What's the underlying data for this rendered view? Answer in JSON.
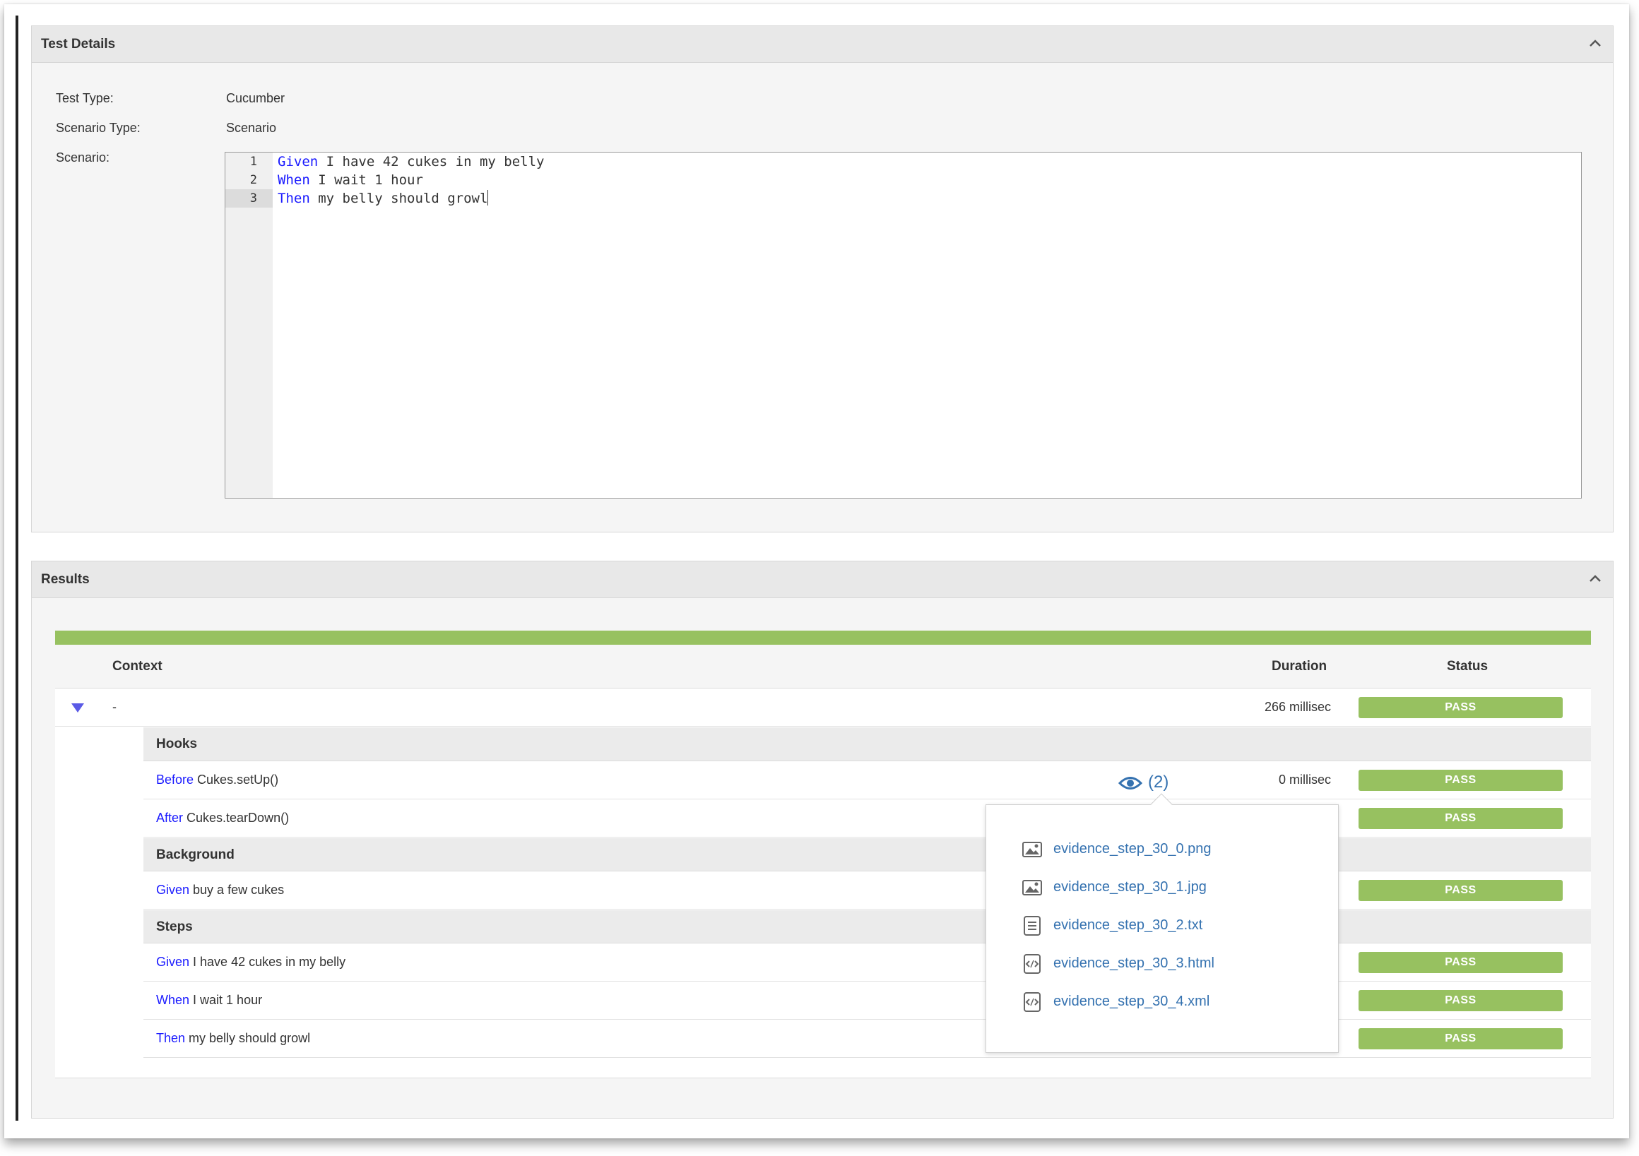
{
  "test_details": {
    "title": "Test Details",
    "fields": {
      "test_type_label": "Test Type:",
      "test_type_value": "Cucumber",
      "scenario_type_label": "Scenario Type:",
      "scenario_type_value": "Scenario",
      "scenario_label": "Scenario:"
    },
    "scenario_lines": [
      {
        "n": "1",
        "kw": "Given",
        "text": " I have 42 cukes in my belly"
      },
      {
        "n": "2",
        "kw": "When",
        "text": " I wait 1 hour"
      },
      {
        "n": "3",
        "kw": "Then",
        "text": " my belly should growl"
      }
    ]
  },
  "results": {
    "title": "Results",
    "progress_pass_fraction": 1.0,
    "columns": {
      "context": "Context",
      "duration": "Duration",
      "status": "Status"
    },
    "summary_row": {
      "context": "-",
      "duration": "266 millisec",
      "status": "PASS"
    },
    "sections": {
      "hooks": "Hooks",
      "background": "Background",
      "steps": "Steps"
    },
    "hooks": [
      {
        "kw": "Before",
        "text": " Cukes.setUp()",
        "duration": "0 millisec",
        "status": "PASS",
        "evidence_count": "(2)"
      },
      {
        "kw": "After",
        "text": " Cukes.tearDown()",
        "status": "PASS"
      }
    ],
    "background": [
      {
        "kw": "Given",
        "text": " buy a few cukes",
        "status": "PASS"
      }
    ],
    "steps": [
      {
        "kw": "Given",
        "text": " I have 42 cukes in my belly",
        "status": "PASS"
      },
      {
        "kw": "When",
        "text": " I wait 1 hour",
        "status": "PASS"
      },
      {
        "kw": "Then",
        "text": " my belly should growl",
        "status": "PASS"
      }
    ],
    "evidence_files": [
      {
        "name": "evidence_step_30_0.png",
        "icon": "image-file-icon"
      },
      {
        "name": "evidence_step_30_1.jpg",
        "icon": "image-file-icon"
      },
      {
        "name": "evidence_step_30_2.txt",
        "icon": "text-file-icon"
      },
      {
        "name": "evidence_step_30_3.html",
        "icon": "code-file-icon"
      },
      {
        "name": "evidence_step_30_4.xml",
        "icon": "code-file-icon"
      }
    ]
  },
  "colors": {
    "pass": "#97c160",
    "keyword": "#1a1aff",
    "link": "#3572b0"
  }
}
